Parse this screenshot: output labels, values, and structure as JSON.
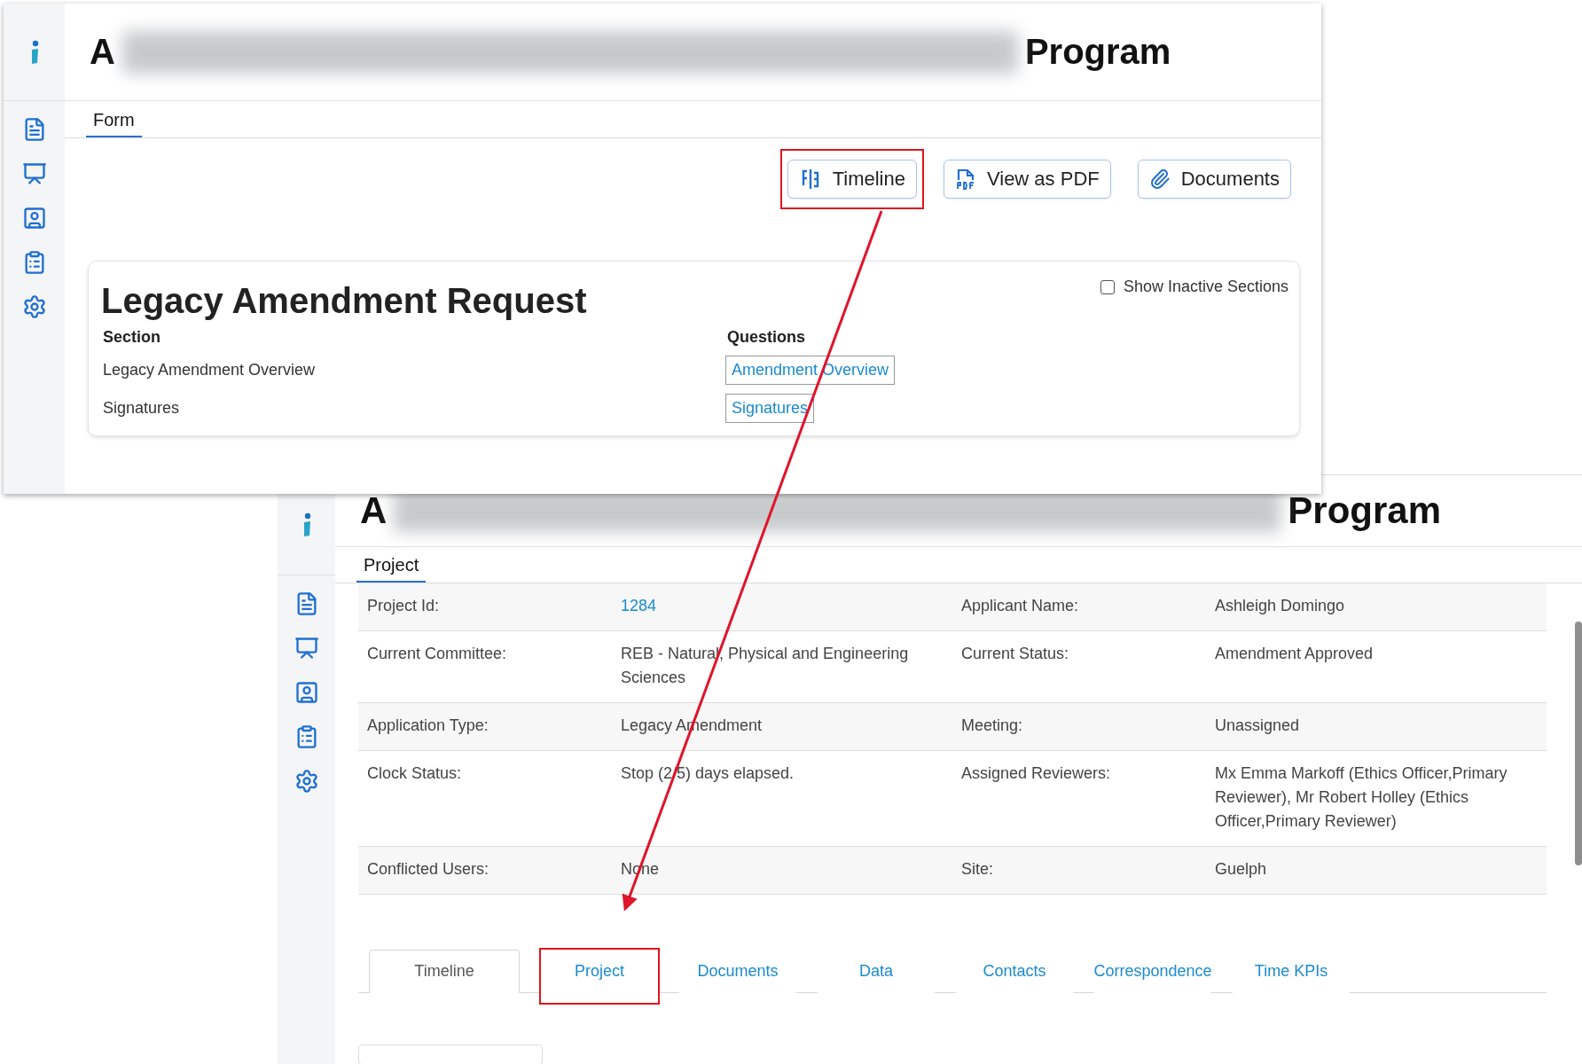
{
  "front_window": {
    "title_start": "A",
    "title_end": "Program",
    "tabs": [
      {
        "label": "Form",
        "selected": true
      }
    ],
    "actions": [
      {
        "label": "Timeline",
        "kind": "timeline",
        "highlighted": true
      },
      {
        "label": "View as PDF",
        "kind": "pdf",
        "highlighted": false
      },
      {
        "label": "Documents",
        "kind": "attach",
        "highlighted": false
      }
    ],
    "card": {
      "title": "Legacy Amendment Request",
      "show_inactive": {
        "label": "Show Inactive Sections",
        "checked": false
      },
      "columns": [
        "Section",
        "Questions"
      ],
      "rows": [
        {
          "section": "Legacy Amendment Overview",
          "question": "Amendment Overview"
        },
        {
          "section": "Signatures",
          "question": "Signatures"
        }
      ]
    }
  },
  "back_window": {
    "title_start": "A",
    "title_end": "Program",
    "tabs": [
      {
        "label": "Project",
        "selected": true
      }
    ],
    "details": [
      [
        {
          "text": "Project Id:",
          "kind": "label"
        },
        {
          "text": "1284",
          "kind": "link"
        },
        {
          "text": "Applicant Name:",
          "kind": "label"
        },
        {
          "text": "Ashleigh Domingo",
          "kind": "value"
        }
      ],
      [
        {
          "text": "Current Committee:",
          "kind": "label"
        },
        {
          "text": "REB - Natural, Physical and Engineering Sciences",
          "kind": "value"
        },
        {
          "text": "Current Status:",
          "kind": "label"
        },
        {
          "text": "Amendment Approved",
          "kind": "value"
        }
      ],
      [
        {
          "text": "Application Type:",
          "kind": "label"
        },
        {
          "text": "Legacy Amendment",
          "kind": "value"
        },
        {
          "text": "Meeting:",
          "kind": "label"
        },
        {
          "text": "Unassigned",
          "kind": "value"
        }
      ],
      [
        {
          "text": "Clock Status:",
          "kind": "label"
        },
        {
          "text": "Stop (2/5) days elapsed.",
          "kind": "value"
        },
        {
          "text": "Assigned Reviewers:",
          "kind": "label"
        },
        {
          "text": "Mx Emma Markoff (Ethics Officer,Primary Reviewer), Mr Robert Holley (Ethics Officer,Primary Reviewer)",
          "kind": "value"
        }
      ],
      [
        {
          "text": "Conflicted Users:",
          "kind": "label"
        },
        {
          "text": "None",
          "kind": "value"
        },
        {
          "text": "Site:",
          "kind": "label"
        },
        {
          "text": "Guelph",
          "kind": "value"
        }
      ]
    ],
    "bottom_tabs": [
      {
        "label": "Timeline",
        "selected": true,
        "highlighted": false
      },
      {
        "label": "Project",
        "selected": false,
        "highlighted": true
      },
      {
        "label": "Documents",
        "selected": false,
        "highlighted": false
      },
      {
        "label": "Data",
        "selected": false,
        "highlighted": false
      },
      {
        "label": "Contacts",
        "selected": false,
        "highlighted": false
      },
      {
        "label": "Correspondence",
        "selected": false,
        "highlighted": false
      },
      {
        "label": "Time KPIs",
        "selected": false,
        "highlighted": false
      }
    ]
  }
}
